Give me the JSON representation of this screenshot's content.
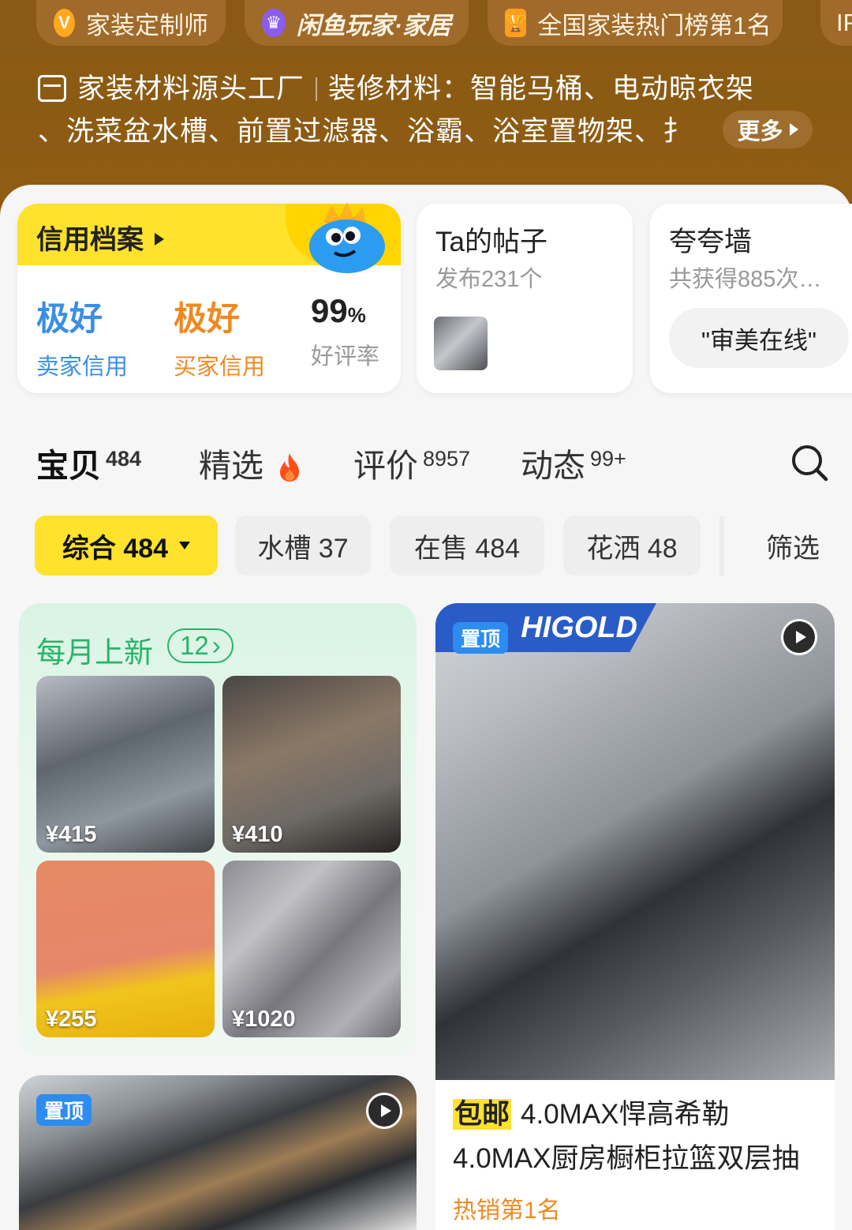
{
  "header": {
    "badges": [
      {
        "icon": "V",
        "label": "家装定制师"
      },
      {
        "icon": "♛",
        "label": "闲鱼玩家·家居"
      },
      {
        "icon": "🏆",
        "label": "全国家装热门榜第1名"
      },
      {
        "icon": "",
        "label": "IP"
      }
    ],
    "factory_title": "家装材料源头工厂",
    "materials_line1": "装修材料：智能马桶、电动晾衣架",
    "materials_line2": "、洗菜盆水槽、前置过滤器、浴霸、浴室置物架、扌",
    "more_label": "更多"
  },
  "credit": {
    "title": "信用档案",
    "stats": [
      {
        "value": "极好",
        "label": "卖家信用"
      },
      {
        "value": "极好",
        "label": "买家信用"
      },
      {
        "value": "99",
        "unit": "%",
        "label": "好评率"
      }
    ]
  },
  "posts": {
    "title": "Ta的帖子",
    "subtitle": "发布231个"
  },
  "wall": {
    "title": "夸夸墙",
    "subtitle": "共获得885次…",
    "pill": "\"审美在线\""
  },
  "tabs": [
    {
      "label": "宝贝",
      "count": "484"
    },
    {
      "label": "精选",
      "count": ""
    },
    {
      "label": "评价",
      "count": "8957"
    },
    {
      "label": "动态",
      "count": "99+"
    }
  ],
  "filters": {
    "comprehensive": "综合 484",
    "sink": "水槽 37",
    "on_sale": "在售 484",
    "shower": "花洒 48",
    "filter": "筛选"
  },
  "monthly": {
    "title": "每月上新",
    "count": "12",
    "items": [
      {
        "price": "¥415"
      },
      {
        "price": "¥410"
      },
      {
        "price": "¥255"
      },
      {
        "price": "¥1020"
      }
    ]
  },
  "product": {
    "brand": "HIGOLD",
    "pin_label": "置顶",
    "free_shipping": "包邮",
    "title": "4.0MAX悍高希勒4.0MAX厨房橱柜拉篮双层抽",
    "rank": "热销第1名"
  },
  "second_card": {
    "pin_label": "置顶"
  },
  "colors": {
    "header_bg": "#8a5a14",
    "accent_yellow": "#ffe22b",
    "green": "#28b36a",
    "blue": "#3a8ee6",
    "orange": "#ee8a22"
  }
}
